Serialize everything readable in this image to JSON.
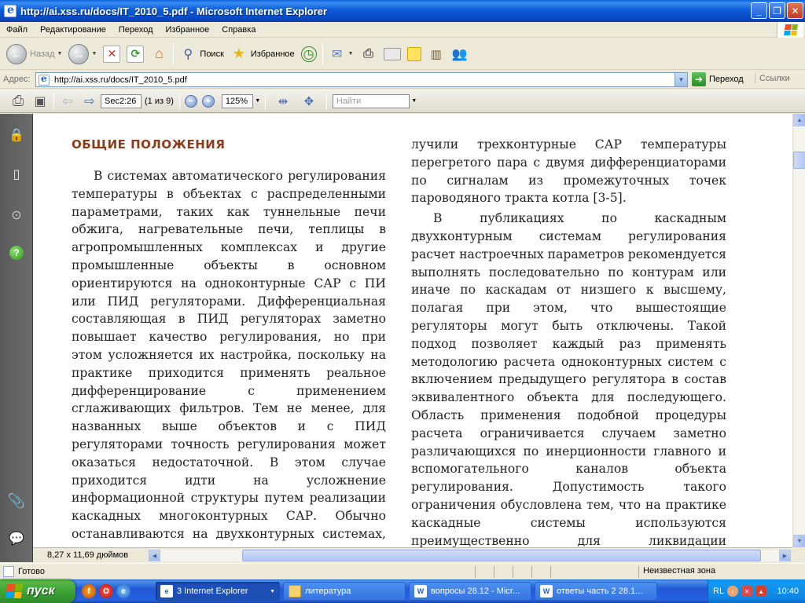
{
  "window": {
    "title": "http://ai.xss.ru/docs/IT_2010_5.pdf - Microsoft Internet Explorer",
    "minimize": "_",
    "maximize": "❐",
    "close": "✕"
  },
  "menu": [
    "Файл",
    "Редактирование",
    "Переход",
    "Избранное",
    "Справка"
  ],
  "toolbar": {
    "back": "Назад",
    "search": "Поиск",
    "favorites": "Избранное"
  },
  "address": {
    "label": "Адрес:",
    "url": "http://ai.xss.ru/docs/IT_2010_5.pdf",
    "go": "Переход",
    "links": "Ссылки"
  },
  "pdf_toolbar": {
    "page_label": "Sec2:26",
    "page_count": "(1 из 9)",
    "zoom": "125%",
    "find_placeholder": "Найти"
  },
  "document": {
    "heading": "ОБЩИЕ ПОЛОЖЕНИЯ",
    "left_column": "В системах автоматического регулирования температуры в объектах с распределенными параметрами, таких как туннельные печи обжига, нагревательные печи, теплицы в агропромышленных комплексах и другие промышленные объекты в основном ориентируются на одноконтурные САР с ПИ или ПИД регуляторами. Дифференциальная составляющая в ПИД регуляторах заметно повышает качество регулирования, но при этом усложняется их настройка, поскольку на практике приходится применять реальное дифференцирование с применением сглаживающих фильтров. Тем не менее, для названных выше объектов и с ПИД регуляторами точность регулирования может оказаться недостаточной. В этом случае приходится идти на усложнение информационной структуры путем реализации каскадных многоконтурных САР. Обычно останавливаются на двухконтурных системах, хотя в ряде слу-",
    "right_column_p1": "лучили трехконтурные САР температуры перегретого пара с двумя дифференциаторами по сигналам из промежуточных точек пароводяного тракта котла [3-5].",
    "right_column_p2": "В публикациях по каскадным двухконтурным системам регулирования расчет настроечных параметров рекомендуется выполнять последовательно по контурам или иначе по каскадам от низшего к высшему, полагая при этом, что вышестоящие регуляторы могут быть отключены. Такой подход позволяет каждый раз применять методологию расчета одноконтурных систем с включением предыдущего регулятора в состав эквивалентного объекта для последующего. Область применения подобной процедуры расчета ограничивается случаем заметно различающихся по инерционности главного и вспомогательного каналов объекта регулирования. Допустимость такого ограничения обусловлена тем, что на практике каскадные системы используются преимущественно для ликвидации возмущений, идущих со стороны регулирующего органа, поэтому"
  },
  "pagebar": {
    "size": "8,27 x 11,69 дюймов"
  },
  "status": {
    "left": "Готово",
    "zone": "Неизвестная зона"
  },
  "taskbar": {
    "start": "пуск",
    "tasks": [
      {
        "label": "3 Internet Explorer",
        "active": true
      },
      {
        "label": "литература",
        "active": false
      },
      {
        "label": "вопросы 28.12 - Micr...",
        "active": false
      },
      {
        "label": "ответы часть 2 28.1...",
        "active": false
      }
    ],
    "lang": "RL",
    "clock": "10:40"
  }
}
